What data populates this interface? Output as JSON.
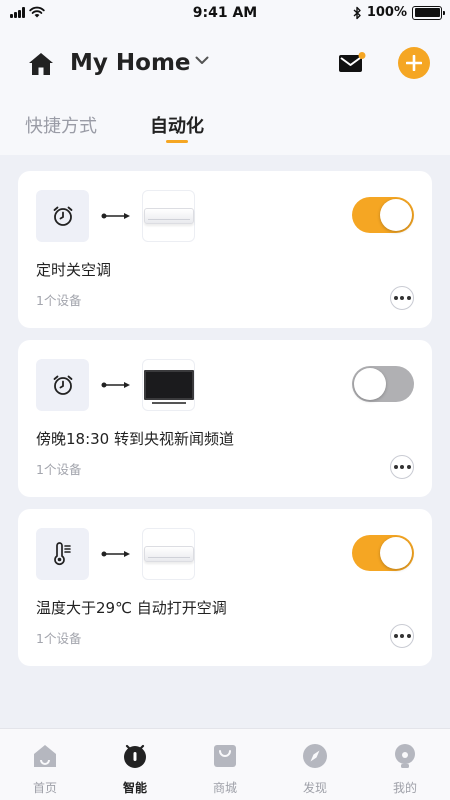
{
  "status_bar": {
    "time": "9:41 AM",
    "battery": "100%"
  },
  "header": {
    "title": "My Home"
  },
  "tabs": [
    {
      "label": "快捷方式"
    },
    {
      "label": "自动化"
    }
  ],
  "automations": [
    {
      "title": "定时关空调",
      "subtitle": "1个设备",
      "trigger_icon": "alarm-clock-icon",
      "device": "air-conditioner",
      "enabled": true
    },
    {
      "title": "傍晚18:30 转到央视新闻频道",
      "subtitle": "1个设备",
      "trigger_icon": "alarm-clock-icon",
      "device": "television",
      "enabled": false
    },
    {
      "title": "温度大于29℃ 自动打开空调",
      "subtitle": "1个设备",
      "trigger_icon": "thermometer-icon",
      "device": "air-conditioner",
      "enabled": true
    }
  ],
  "nav": [
    {
      "label": "首页",
      "icon": "home-icon"
    },
    {
      "label": "智能",
      "icon": "smart-icon",
      "active": true
    },
    {
      "label": "商城",
      "icon": "shop-bag-icon"
    },
    {
      "label": "发现",
      "icon": "compass-icon"
    },
    {
      "label": "我的",
      "icon": "profile-icon"
    }
  ],
  "colors": {
    "accent": "#f5a623",
    "toggle_off": "#b0b0b3",
    "background": "#eef0f6"
  }
}
